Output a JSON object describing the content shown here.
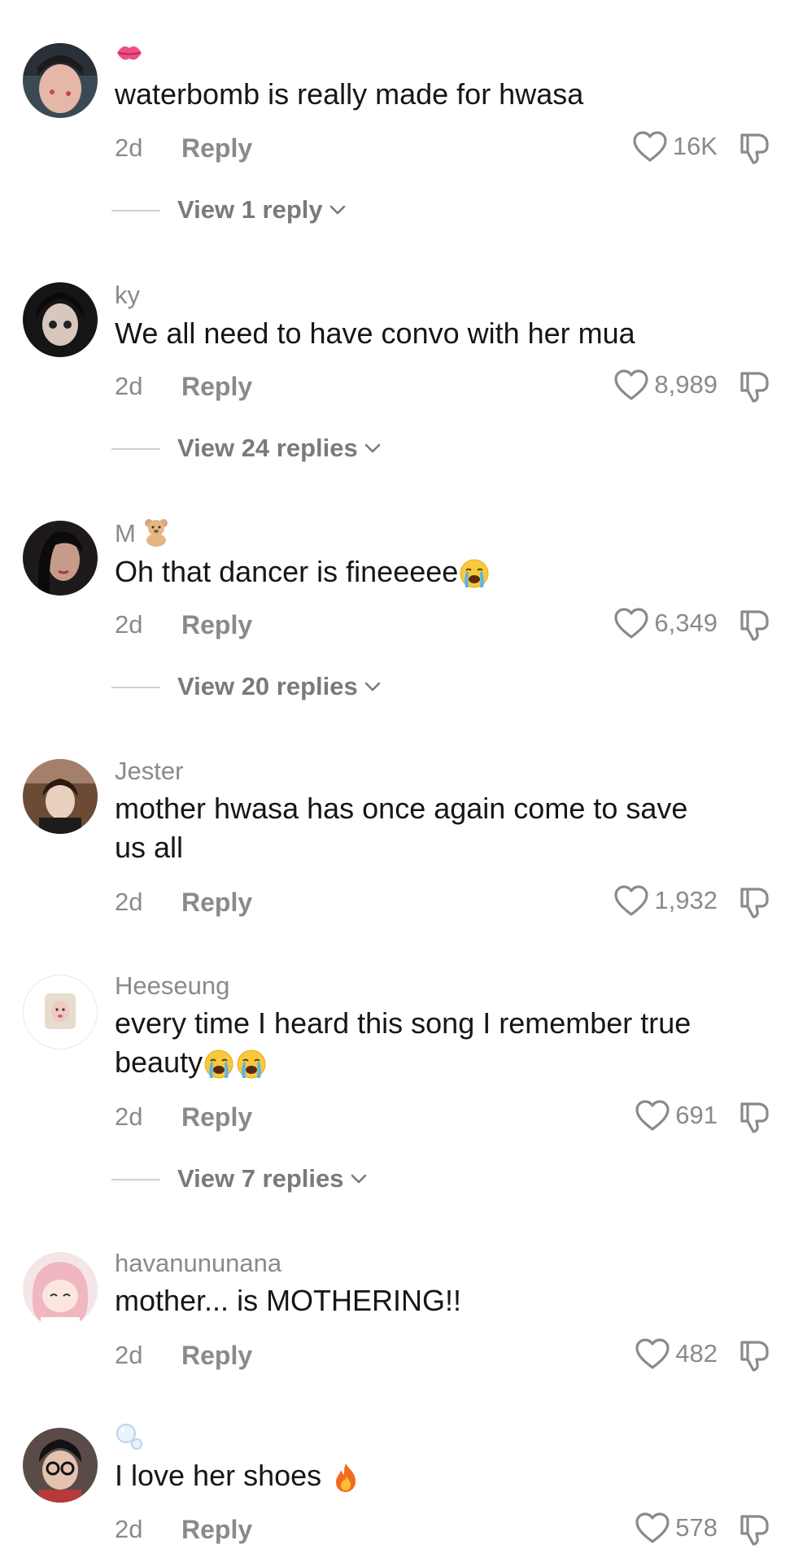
{
  "comments": [
    {
      "username": "",
      "text": "waterbomb is really made for hwasa",
      "time": "2d",
      "reply_label": "Reply",
      "likes": "16K",
      "view_replies": "View 1 reply"
    },
    {
      "username": "ky",
      "text": "We all need to have convo with her mua",
      "time": "2d",
      "reply_label": "Reply",
      "likes": "8,989",
      "view_replies": "View 24 replies"
    },
    {
      "username": "M",
      "text": "Oh that dancer is fineeeee",
      "time": "2d",
      "reply_label": "Reply",
      "likes": "6,349",
      "view_replies": "View 20 replies"
    },
    {
      "username": "Jester",
      "text_line1": "mother hwasa has once again come to save",
      "text_line2": "us all",
      "time": "2d",
      "reply_label": "Reply",
      "likes": "1,932"
    },
    {
      "username": "Heeseung",
      "text_line1": "every time I heard this song I remember true",
      "text_line2": "beauty",
      "time": "2d",
      "reply_label": "Reply",
      "likes": "691",
      "view_replies": "View 7 replies"
    },
    {
      "username": "havanununana",
      "text": "mother... is MOTHERING!!",
      "time": "2d",
      "reply_label": "Reply",
      "likes": "482"
    },
    {
      "username": "",
      "text": "I love her shoes",
      "time": "2d",
      "reply_label": "Reply",
      "likes": "578"
    }
  ],
  "icons": {
    "like": "heart-outline-icon",
    "dislike": "thumb-down-icon",
    "expand": "chevron-down-icon",
    "username_badges": [
      "kiss-lips-emoji",
      "teddy-bear-emoji",
      "bubbles-emoji"
    ],
    "text_emojis": [
      "loudly-crying-emoji",
      "fire-emoji"
    ]
  },
  "colors": {
    "text": "#161616",
    "secondary": "#8a8a8a",
    "divider": "#cfcfcf",
    "background": "#ffffff"
  }
}
